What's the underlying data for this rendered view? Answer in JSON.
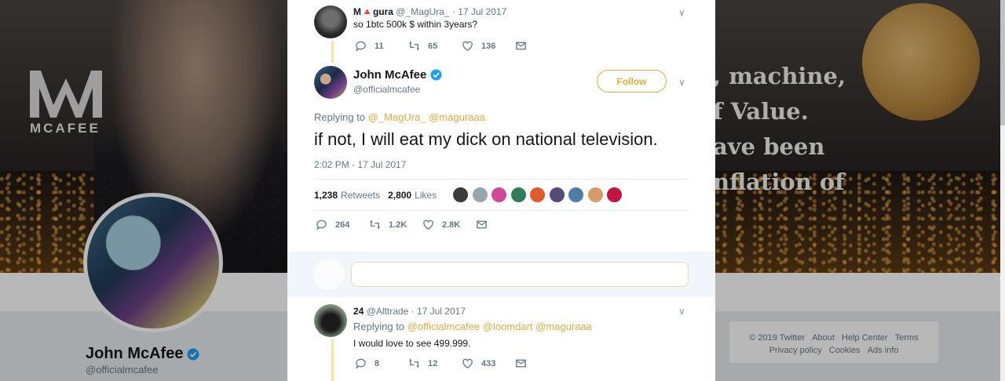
{
  "background": {
    "brand_name": "MCAFEE",
    "banner_lines": [
      ", machine,",
      "f Value.",
      "ave been",
      "nflation of"
    ],
    "profile_name": "John McAfee",
    "profile_handle": "@officialmcafee",
    "footer_links": [
      "© 2019 Twitter",
      "About",
      "Help Center",
      "Terms",
      "Privacy policy",
      "Cookies",
      "Ads info"
    ]
  },
  "colors": {
    "accent": "#e6a93a",
    "verified": "#1da1f2",
    "muted": "#657786",
    "thread_line": "#f5e3a1"
  },
  "parent_tweet": {
    "display_name": "M🔺gura",
    "handle": "@_MagUra_",
    "date": "17 Jul 2017",
    "text": "so 1btc 500k $ within 3years?",
    "replies": "11",
    "retweets": "65",
    "likes": "136"
  },
  "main_tweet": {
    "display_name": "John McAfee",
    "handle": "@officialmcafee",
    "follow_label": "Follow",
    "replying_prefix": "Replying to",
    "replying_to": [
      "@_MagUra_",
      "@maguraaa"
    ],
    "text": "if not, I will eat my dick on national television.",
    "timestamp": "2:02 PM - 17 Jul 2017",
    "retweets_count": "1,238",
    "retweets_label": "Retweets",
    "likes_count": "2,800",
    "likes_label": "Likes",
    "liker_colors": [
      "#3b3b3b",
      "#9aa4ab",
      "#d0489a",
      "#2e7d5b",
      "#e05a2a",
      "#5a4a7a",
      "#4e7ea8",
      "#d89a68",
      "#c4143e"
    ],
    "replies": "264",
    "retweets": "1.2K",
    "likes": "2.8K"
  },
  "reply_tweet": {
    "display_name": "24",
    "handle": "@Alttrade",
    "date": "17 Jul 2017",
    "replying_prefix": "Replying to",
    "replying_to": [
      "@officialmcafee",
      "@loomdart",
      "@maguraaa"
    ],
    "text": "I would love to see 499.999.",
    "replies": "8",
    "retweets": "12",
    "likes": "433"
  }
}
